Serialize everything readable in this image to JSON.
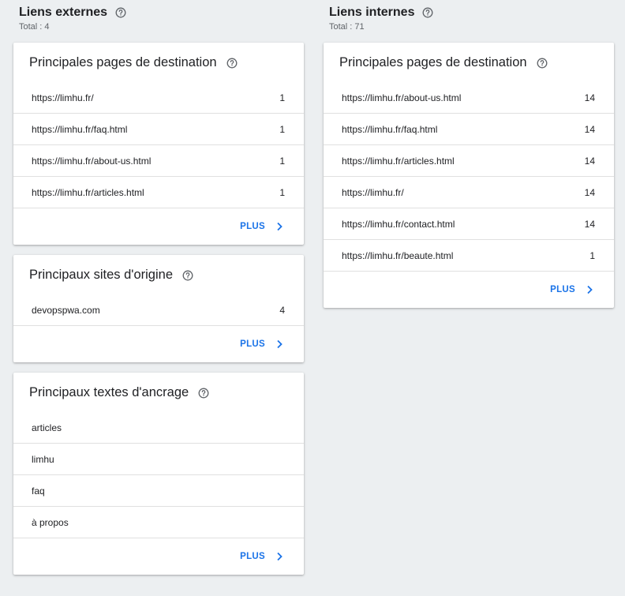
{
  "external": {
    "title": "Liens externes",
    "total": "Total : 4",
    "top_pages": {
      "title": "Principales pages de destination",
      "rows": [
        {
          "label": "https://limhu.fr/",
          "count": "1"
        },
        {
          "label": "https://limhu.fr/faq.html",
          "count": "1"
        },
        {
          "label": "https://limhu.fr/about-us.html",
          "count": "1"
        },
        {
          "label": "https://limhu.fr/articles.html",
          "count": "1"
        }
      ],
      "more": "PLUS"
    },
    "top_sites": {
      "title": "Principaux sites d'origine",
      "rows": [
        {
          "label": "devopspwa.com",
          "count": "4"
        }
      ],
      "more": "PLUS"
    },
    "top_anchors": {
      "title": "Principaux textes d'ancrage",
      "rows": [
        {
          "label": "articles"
        },
        {
          "label": "limhu"
        },
        {
          "label": "faq"
        },
        {
          "label": "à propos"
        }
      ],
      "more": "PLUS"
    }
  },
  "internal": {
    "title": "Liens internes",
    "total": "Total : 71",
    "top_pages": {
      "title": "Principales pages de destination",
      "rows": [
        {
          "label": "https://limhu.fr/about-us.html",
          "count": "14"
        },
        {
          "label": "https://limhu.fr/faq.html",
          "count": "14"
        },
        {
          "label": "https://limhu.fr/articles.html",
          "count": "14"
        },
        {
          "label": "https://limhu.fr/",
          "count": "14"
        },
        {
          "label": "https://limhu.fr/contact.html",
          "count": "14"
        },
        {
          "label": "https://limhu.fr/beaute.html",
          "count": "1"
        }
      ],
      "more": "PLUS"
    }
  },
  "icons": {
    "help": "help-circle-icon",
    "more": "chevron-right-icon"
  },
  "colors": {
    "background": "#eceff1",
    "card": "#ffffff",
    "accent": "#1a73e8",
    "divider": "#e0e0e0"
  }
}
